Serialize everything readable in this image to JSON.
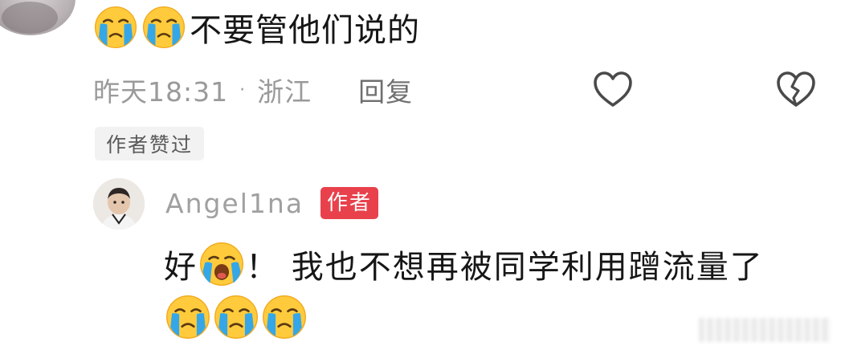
{
  "comment": {
    "emoji_prefix": [
      "loudly-crying-face",
      "loudly-crying-face"
    ],
    "text": "不要管他们说的",
    "time": "昨天18:31",
    "separator": "·",
    "location": "浙江",
    "reply_label": "回复",
    "author_liked_label": "作者赞过"
  },
  "reply": {
    "username": "Angel1na",
    "author_tag": "作者",
    "text_start": "好",
    "emoji_mid": "loudly-crying-face",
    "text_rest": "！ 我也不想再被同学利用蹭流量了",
    "emoji_suffix": [
      "loudly-crying-face",
      "loudly-crying-face",
      "loudly-crying-face"
    ]
  },
  "colors": {
    "author_tag_bg": "#e8414c",
    "meta_text": "#9a9a9a",
    "badge_bg": "#f2f2f2"
  },
  "icons": [
    "like-heart-icon",
    "broken-heart-icon"
  ]
}
